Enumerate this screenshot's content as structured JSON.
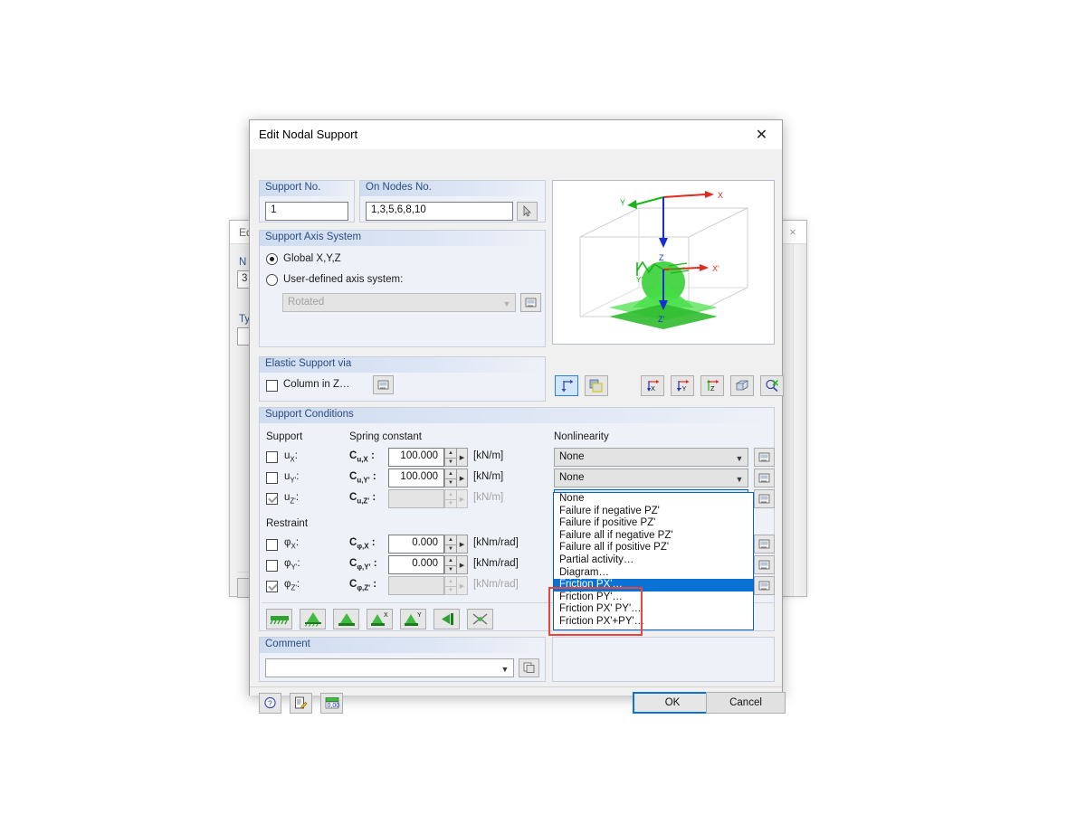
{
  "background_windows": {
    "left": {
      "title": "Ed",
      "group1_label": "N",
      "field1_value": "3",
      "group2_label": "Ty"
    },
    "right": {
      "close_label": "×"
    }
  },
  "dialog": {
    "title": "Edit Nodal Support",
    "close_label": "✕",
    "support_no": {
      "group_label": "Support No.",
      "value": "1"
    },
    "on_nodes": {
      "group_label": "On Nodes No.",
      "value": "1,3,5,6,8,10",
      "pick_icon": "pick-cursor-icon"
    },
    "axis_system": {
      "group_label": "Support Axis System",
      "global_option": "Global X,Y,Z",
      "global_selected": true,
      "user_option": "User-defined axis system:",
      "user_selected": false,
      "combo_value": "Rotated",
      "combo_disabled": true,
      "edit_icon": "edit-dialog-icon"
    },
    "elastic_support": {
      "group_label": "Elastic Support via",
      "checkbox_label": "Column in Z…",
      "checked": false,
      "edit_icon": "edit-dialog-icon"
    },
    "support_conditions": {
      "group_label": "Support Conditions",
      "col_support": "Support",
      "col_spring": "Spring constant",
      "col_nonlinearity": "Nonlinearity",
      "restraint_label": "Restraint",
      "rows": [
        {
          "key": "uX",
          "label_main": "u",
          "label_sub": "X",
          "checked": false,
          "spring_label_main": "C",
          "spring_label_sub": "u,X",
          "spring_value": "100.000",
          "unit": "[kN/m]",
          "disabled": false,
          "nonlinearity": "None"
        },
        {
          "key": "uY",
          "label_main": "u",
          "label_sub": "Y'",
          "checked": false,
          "spring_label_main": "C",
          "spring_label_sub": "u,Y'",
          "spring_value": "100.000",
          "unit": "[kN/m]",
          "disabled": false,
          "nonlinearity": "None"
        },
        {
          "key": "uZ",
          "label_main": "u",
          "label_sub": "Z'",
          "checked": true,
          "spring_label_main": "C",
          "spring_label_sub": "u,Z'",
          "spring_value": "",
          "unit": "[kN/m]",
          "disabled": true,
          "nonlinearity": "None"
        }
      ],
      "restraint_rows": [
        {
          "key": "phiX",
          "label_main": "φ",
          "label_sub": "X",
          "checked": false,
          "spring_label_main": "C",
          "spring_label_sub": "φ,X",
          "spring_value": "0.000",
          "unit": "[kNm/rad]",
          "disabled": false
        },
        {
          "key": "phiY",
          "label_main": "φ",
          "label_sub": "Y'",
          "checked": false,
          "spring_label_main": "C",
          "spring_label_sub": "φ,Y'",
          "spring_value": "0.000",
          "unit": "[kNm/rad]",
          "disabled": false
        },
        {
          "key": "phiZ",
          "label_main": "φ",
          "label_sub": "Z'",
          "checked": true,
          "spring_label_main": "C",
          "spring_label_sub": "φ,Z'",
          "spring_value": "",
          "unit": "[kNm/rad]",
          "disabled": true
        }
      ],
      "preset_buttons": [
        "fixed-line-support-icon",
        "hinged-support-icon",
        "fixed-support-icon",
        "sliding-x-support-icon",
        "sliding-y-support-icon",
        "wall-support-icon",
        "free-node-icon"
      ]
    },
    "nonlinearity_dropdown": {
      "selected_value": "None",
      "options": [
        "None",
        "Failure if negative PZ'",
        "Failure if positive PZ'",
        "Failure all if negative PZ'",
        "Failure all if positive PZ'",
        "Partial activity…",
        "Diagram…",
        "Friction PX'…",
        "Friction PY'…",
        "Friction PX' PY'…",
        "Friction PX'+PY'…"
      ],
      "highlighted_index": 7,
      "highlight_color": "#0a72d4",
      "annotation_box_color": "#e8453c",
      "annotation_first_index": 7,
      "annotation_last_index": 10
    },
    "comment": {
      "group_label": "Comment",
      "value": "",
      "copy_icon": "copy-comment-icon"
    },
    "viewport": {
      "axis_labels": [
        "X",
        "Y",
        "Z",
        "X'",
        "Y'",
        "Z'"
      ],
      "toolbar_left": [
        "show-axes-icon",
        "show-plane-icon"
      ],
      "toolbar_right": [
        "view-x-icon",
        "view-y-icon",
        "view-z-icon",
        "isometric-view-icon",
        "zoom-all-icon"
      ],
      "selected_tool_index": 0
    },
    "footer": {
      "help_icon": "help-icon",
      "notes_icon": "notes-icon",
      "units_icon": "units-icon",
      "ok_label": "OK",
      "cancel_label": "Cancel"
    }
  }
}
